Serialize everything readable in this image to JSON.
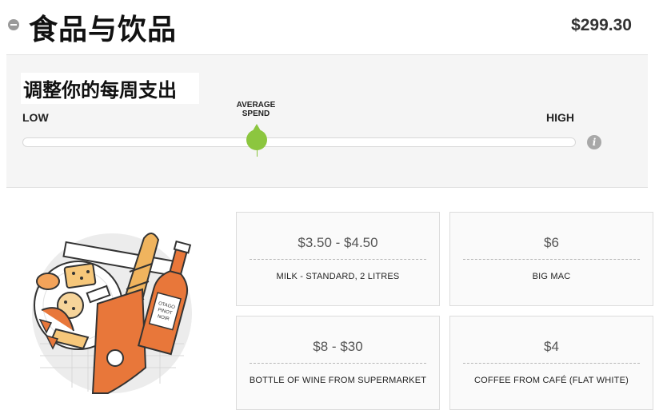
{
  "header": {
    "title": "食品与饮品",
    "total": "$299.30"
  },
  "slider": {
    "title": "调整你的每周支出",
    "low_label": "LOW",
    "high_label": "HIGH",
    "marker_label_line1": "AVERAGE",
    "marker_label_line2": "SPEND",
    "value_fraction": 0.43,
    "info_icon": "i",
    "accent_color": "#8cc63f"
  },
  "illustration": {
    "icon": "food-and-wine-illustration",
    "bottle_label_line1": "OTAGO",
    "bottle_label_line2": "PINOT",
    "bottle_label_line3": "NOIR",
    "accent_color": "#e8773a"
  },
  "cards": [
    {
      "price": "$3.50 - $4.50",
      "item": "MILK - STANDARD, 2 LITRES"
    },
    {
      "price": "$6",
      "item": "BIG MAC"
    },
    {
      "price": "$8 - $30",
      "item": "BOTTLE OF WINE FROM SUPERMARKET"
    },
    {
      "price": "$4",
      "item": "COFFEE FROM CAFÉ (FLAT WHITE)"
    }
  ]
}
